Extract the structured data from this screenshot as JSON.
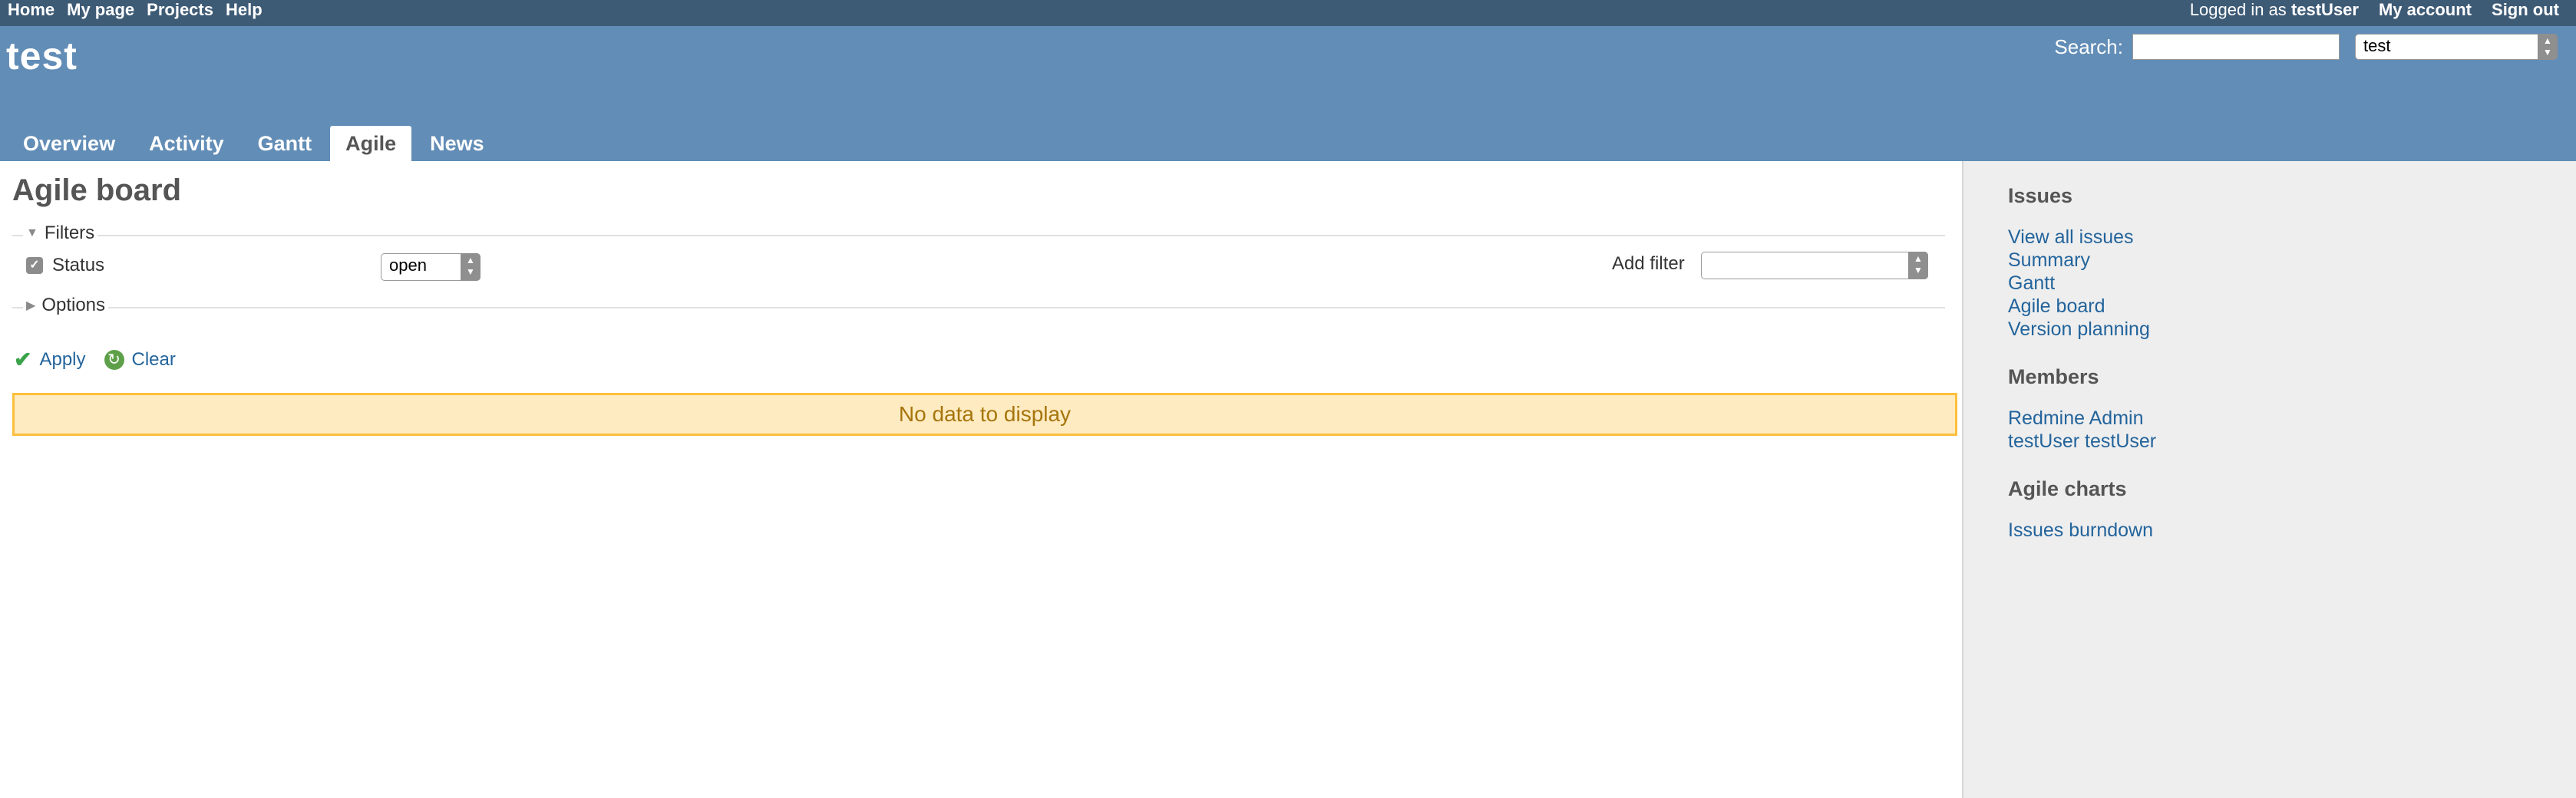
{
  "top_menu": {
    "left_links": [
      "Home",
      "My page",
      "Projects",
      "Help"
    ],
    "logged_in_prefix": "Logged in as",
    "user": "testUser",
    "my_account": "My account",
    "sign_out": "Sign out"
  },
  "header": {
    "project_title": "test",
    "search_label": "Search:",
    "search_value": "",
    "project_jump_value": "test"
  },
  "main_menu": {
    "tabs": [
      {
        "label": "Overview",
        "selected": false
      },
      {
        "label": "Activity",
        "selected": false
      },
      {
        "label": "Gantt",
        "selected": false
      },
      {
        "label": "Agile",
        "selected": true
      },
      {
        "label": "News",
        "selected": false
      }
    ]
  },
  "content": {
    "page_title": "Agile board",
    "filters_legend": "Filters",
    "status_filter": {
      "label": "Status",
      "checked": true,
      "value": "open"
    },
    "add_filter_label": "Add filter",
    "add_filter_value": "",
    "options_legend": "Options",
    "apply_label": "Apply",
    "clear_label": "Clear",
    "no_data_message": "No data to display"
  },
  "sidebar": {
    "issues_heading": "Issues",
    "issues_links": [
      "View all issues",
      "Summary",
      "Gantt",
      "Agile board",
      "Version planning"
    ],
    "members_heading": "Members",
    "members": [
      "Redmine Admin",
      "testUser testUser"
    ],
    "charts_heading": "Agile charts",
    "charts_links": [
      "Issues burndown"
    ]
  },
  "colors": {
    "top_menu_bg": "#3e5b76",
    "header_bg": "#628db6",
    "link": "#23649c",
    "nodata_bg": "#ffebc1",
    "nodata_border": "#fdbf3b",
    "sidebar_bg": "#eeeeee"
  }
}
